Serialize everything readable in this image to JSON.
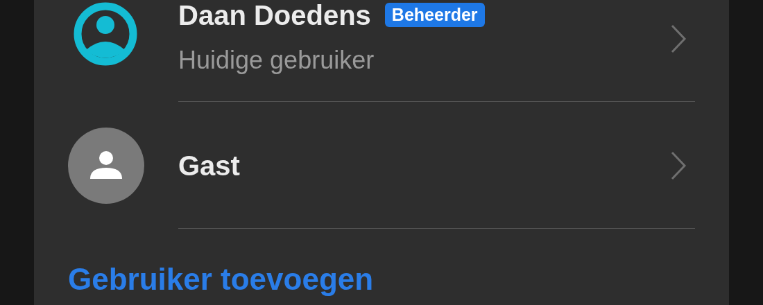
{
  "users": [
    {
      "name": "Daan Doedens",
      "badge": "Beheerder",
      "subtitle": "Huidige gebruiker",
      "kind": "current"
    },
    {
      "name": "Gast",
      "kind": "guest"
    }
  ],
  "add_user_link": "Gebruiker toevoegen"
}
